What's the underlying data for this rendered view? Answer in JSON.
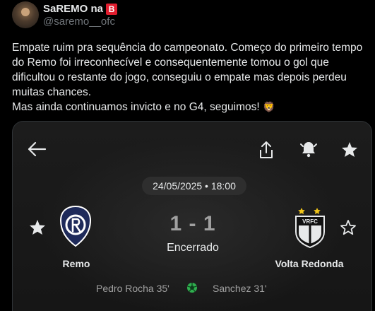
{
  "post": {
    "display_name": "SaREMO na",
    "badge_letter": "B",
    "handle": "@saremo__ofc",
    "text_line1": "Empate ruim pra sequência do campeonato. Começo do primeiro tempo do Remo foi irreconhecível e consequentemente tomou o gol que dificultou o restante do jogo, conseguiu o empate mas depois perdeu muitas chances.",
    "text_line2": "Mas ainda continuamos invicto e no G4, seguimos!",
    "emoji": "🦁"
  },
  "match": {
    "datetime": "24/05/2025 • 18:00",
    "score": "1 - 1",
    "status": "Encerrado",
    "home": {
      "name": "Remo",
      "scorer": "Pedro Rocha 35'"
    },
    "away": {
      "name": "Volta Redonda",
      "scorer": "Sanchez 31'",
      "crest_text": "VRFC"
    }
  },
  "colors": {
    "background": "#000000",
    "card": "#1a1a1a",
    "pill": "#2e2e2e",
    "badge": "#e11d2e",
    "ball": "#2fae4e"
  }
}
